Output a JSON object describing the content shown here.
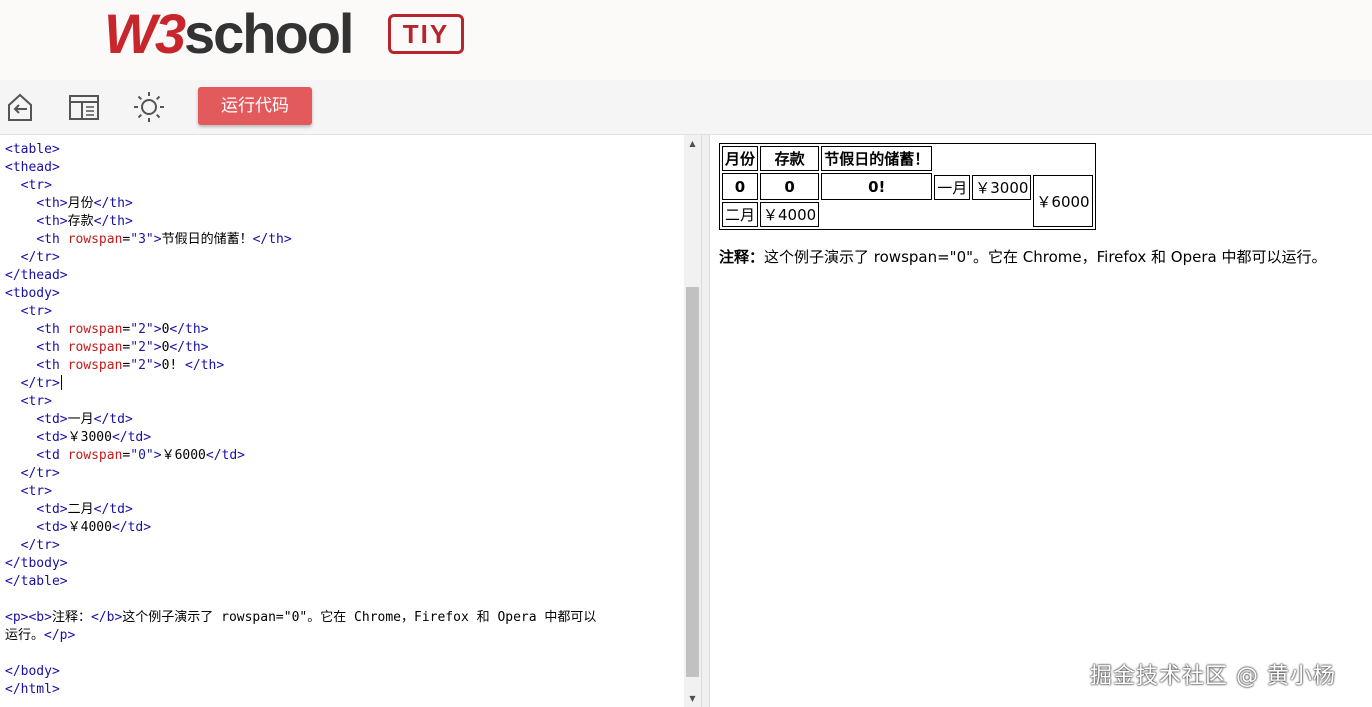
{
  "header": {
    "logo_w3": "W3",
    "logo_school": "school",
    "tiy": "TIY"
  },
  "toolbar": {
    "run_label": "运行代码",
    "icons": [
      "back-icon",
      "layout-icon",
      "theme-icon"
    ]
  },
  "editor": {
    "lines": [
      [
        {
          "c": "tag",
          "t": "<table>"
        }
      ],
      [
        {
          "c": "tag",
          "t": "<thead>"
        }
      ],
      [
        {
          "c": "txt",
          "t": "  "
        },
        {
          "c": "tag",
          "t": "<tr>"
        }
      ],
      [
        {
          "c": "txt",
          "t": "    "
        },
        {
          "c": "tag",
          "t": "<th>"
        },
        {
          "c": "txt",
          "t": "月份"
        },
        {
          "c": "tag",
          "t": "</th>"
        }
      ],
      [
        {
          "c": "txt",
          "t": "    "
        },
        {
          "c": "tag",
          "t": "<th>"
        },
        {
          "c": "txt",
          "t": "存款"
        },
        {
          "c": "tag",
          "t": "</th>"
        }
      ],
      [
        {
          "c": "txt",
          "t": "    "
        },
        {
          "c": "tag",
          "t": "<th "
        },
        {
          "c": "attr",
          "t": "rowspan"
        },
        {
          "c": "txt",
          "t": "="
        },
        {
          "c": "val",
          "t": "\"3\""
        },
        {
          "c": "tag",
          "t": ">"
        },
        {
          "c": "txt",
          "t": "节假日的储蓄！"
        },
        {
          "c": "tag",
          "t": "</th>"
        }
      ],
      [
        {
          "c": "txt",
          "t": "  "
        },
        {
          "c": "tag",
          "t": "</tr>"
        }
      ],
      [
        {
          "c": "tag",
          "t": "</thead>"
        }
      ],
      [
        {
          "c": "tag",
          "t": "<tbody>"
        }
      ],
      [
        {
          "c": "txt",
          "t": "  "
        },
        {
          "c": "tag",
          "t": "<tr>"
        }
      ],
      [
        {
          "c": "txt",
          "t": "    "
        },
        {
          "c": "tag",
          "t": "<th "
        },
        {
          "c": "attr",
          "t": "rowspan"
        },
        {
          "c": "txt",
          "t": "="
        },
        {
          "c": "val",
          "t": "\"2\""
        },
        {
          "c": "tag",
          "t": ">"
        },
        {
          "c": "txt",
          "t": "0"
        },
        {
          "c": "tag",
          "t": "</th>"
        }
      ],
      [
        {
          "c": "txt",
          "t": "    "
        },
        {
          "c": "tag",
          "t": "<th "
        },
        {
          "c": "attr",
          "t": "rowspan"
        },
        {
          "c": "txt",
          "t": "="
        },
        {
          "c": "val",
          "t": "\"2\""
        },
        {
          "c": "tag",
          "t": ">"
        },
        {
          "c": "txt",
          "t": "0"
        },
        {
          "c": "tag",
          "t": "</th>"
        }
      ],
      [
        {
          "c": "txt",
          "t": "    "
        },
        {
          "c": "tag",
          "t": "<th "
        },
        {
          "c": "attr",
          "t": "rowspan"
        },
        {
          "c": "txt",
          "t": "="
        },
        {
          "c": "val",
          "t": "\"2\""
        },
        {
          "c": "tag",
          "t": ">"
        },
        {
          "c": "txt",
          "t": "0! "
        },
        {
          "c": "tag",
          "t": "</th>"
        }
      ],
      [
        {
          "c": "txt",
          "t": "  "
        },
        {
          "c": "tag",
          "t": "</tr>"
        },
        {
          "c": "caret",
          "t": ""
        }
      ],
      [
        {
          "c": "txt",
          "t": "  "
        },
        {
          "c": "tag",
          "t": "<tr>"
        }
      ],
      [
        {
          "c": "txt",
          "t": "    "
        },
        {
          "c": "tag",
          "t": "<td>"
        },
        {
          "c": "txt",
          "t": "一月"
        },
        {
          "c": "tag",
          "t": "</td>"
        }
      ],
      [
        {
          "c": "txt",
          "t": "    "
        },
        {
          "c": "tag",
          "t": "<td>"
        },
        {
          "c": "txt",
          "t": "￥3000"
        },
        {
          "c": "tag",
          "t": "</td>"
        }
      ],
      [
        {
          "c": "txt",
          "t": "    "
        },
        {
          "c": "tag",
          "t": "<td "
        },
        {
          "c": "attr",
          "t": "rowspan"
        },
        {
          "c": "txt",
          "t": "="
        },
        {
          "c": "val",
          "t": "\"0\""
        },
        {
          "c": "tag",
          "t": ">"
        },
        {
          "c": "txt",
          "t": "￥6000"
        },
        {
          "c": "tag",
          "t": "</td>"
        }
      ],
      [
        {
          "c": "txt",
          "t": "  "
        },
        {
          "c": "tag",
          "t": "</tr>"
        }
      ],
      [
        {
          "c": "txt",
          "t": "  "
        },
        {
          "c": "tag",
          "t": "<tr>"
        }
      ],
      [
        {
          "c": "txt",
          "t": "    "
        },
        {
          "c": "tag",
          "t": "<td>"
        },
        {
          "c": "txt",
          "t": "二月"
        },
        {
          "c": "tag",
          "t": "</td>"
        }
      ],
      [
        {
          "c": "txt",
          "t": "    "
        },
        {
          "c": "tag",
          "t": "<td>"
        },
        {
          "c": "txt",
          "t": "￥4000"
        },
        {
          "c": "tag",
          "t": "</td>"
        }
      ],
      [
        {
          "c": "txt",
          "t": "  "
        },
        {
          "c": "tag",
          "t": "</tr>"
        }
      ],
      [
        {
          "c": "tag",
          "t": "</tbody>"
        }
      ],
      [
        {
          "c": "tag",
          "t": "</table>"
        }
      ],
      [],
      [
        {
          "c": "tag",
          "t": "<p><b>"
        },
        {
          "c": "txt",
          "t": "注释："
        },
        {
          "c": "tag",
          "t": "</b>"
        },
        {
          "c": "txt",
          "t": "这个例子演示了 rowspan=\"0\"。它在 Chrome，Firefox 和 Opera 中都可以"
        }
      ],
      [
        {
          "c": "txt",
          "t": "运行。"
        },
        {
          "c": "tag",
          "t": "</p>"
        }
      ],
      [],
      [
        {
          "c": "tag",
          "t": "</body>"
        }
      ],
      [
        {
          "c": "tag",
          "t": "</html>"
        }
      ]
    ]
  },
  "preview": {
    "table": {
      "head": [
        "月份",
        "存款",
        "节假日的储蓄！"
      ],
      "row1": {
        "th1": "0",
        "th2": "0",
        "th3": "0!",
        "td1": "一月",
        "td2": "￥3000",
        "td3": "￥6000"
      },
      "row2": {
        "td1": "二月",
        "td2": "￥4000"
      }
    },
    "note_bold": "注释：",
    "note_text": "这个例子演示了 rowspan=\"0\"。它在 Chrome，Firefox 和 Opera 中都可以运行。"
  },
  "watermark": "掘金技术社区 @ 黄小杨"
}
